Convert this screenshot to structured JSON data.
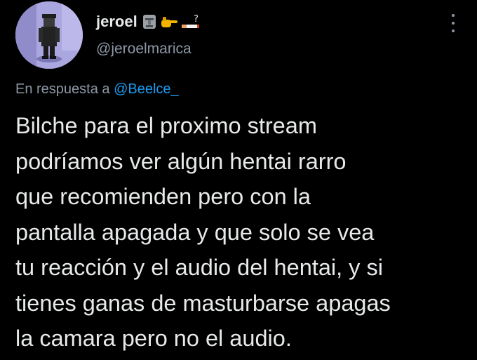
{
  "author": {
    "display_name": "jeroel",
    "handle": "@jeroelmarica",
    "name_emojis": [
      "moai-icon",
      "pointing-hand-icon",
      "cigarette-icon",
      "question-icon"
    ]
  },
  "reply": {
    "prefix": "En respuesta a ",
    "mention": "@Beelce_"
  },
  "tweet": {
    "lines": [
      "Bilche para el proximo stream",
      "podríamos ver algún hentai rarro",
      "que recomienden pero con la",
      "pantalla apagada y que solo se vea",
      "tu reacción y el audio del hentai, y si",
      "tienes ganas de masturbarse apagas",
      "la camara pero no el audio."
    ]
  },
  "colors": {
    "background": "#000000",
    "text": "#e7e9ea",
    "secondary": "#8b98a5",
    "link": "#1d9bf0"
  }
}
